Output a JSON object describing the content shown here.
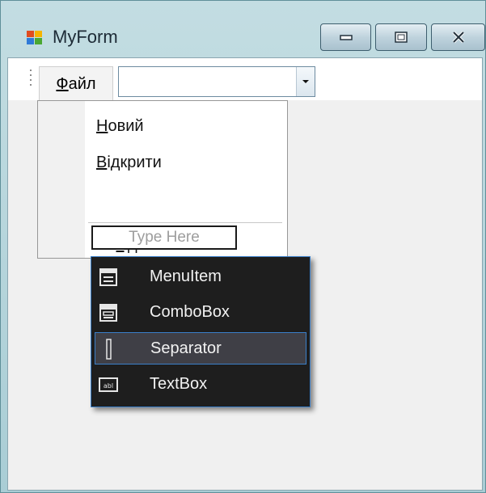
{
  "window": {
    "title": "MyForm",
    "icon": "winforms-app-icon",
    "controls": [
      "minimize-icon",
      "maximize-icon",
      "close-icon"
    ]
  },
  "menustrip": {
    "file_menu_label": "Файл",
    "file_menu_accel": "Ф",
    "file_menu_rest": "айл",
    "combo_value": "",
    "combo_arrow_icon": "chevron-down-icon"
  },
  "file_menu": {
    "items": [
      {
        "label": "Новий",
        "accel": "Н",
        "rest": "овий"
      },
      {
        "label": "Відкрити",
        "accel": "В",
        "rest": "ідкрити"
      },
      {
        "label": "Вихід",
        "pre": "Ви",
        "accel": "х",
        "rest": "ід"
      }
    ],
    "type_here_placeholder": "Type Here"
  },
  "add_item_popup": {
    "items": [
      {
        "label": "MenuItem",
        "icon": "menuitem-icon",
        "selected": false
      },
      {
        "label": "ComboBox",
        "icon": "combobox-icon",
        "selected": false
      },
      {
        "label": "Separator",
        "icon": "separator-icon",
        "selected": true
      },
      {
        "label": "TextBox",
        "icon": "textbox-icon",
        "selected": false
      }
    ]
  },
  "colors": {
    "popup_bg": "#1e1e1e",
    "popup_selected_bg": "#3f3f46",
    "popup_border": "#3a7fc9",
    "form_bg": "#f0f0f0"
  }
}
